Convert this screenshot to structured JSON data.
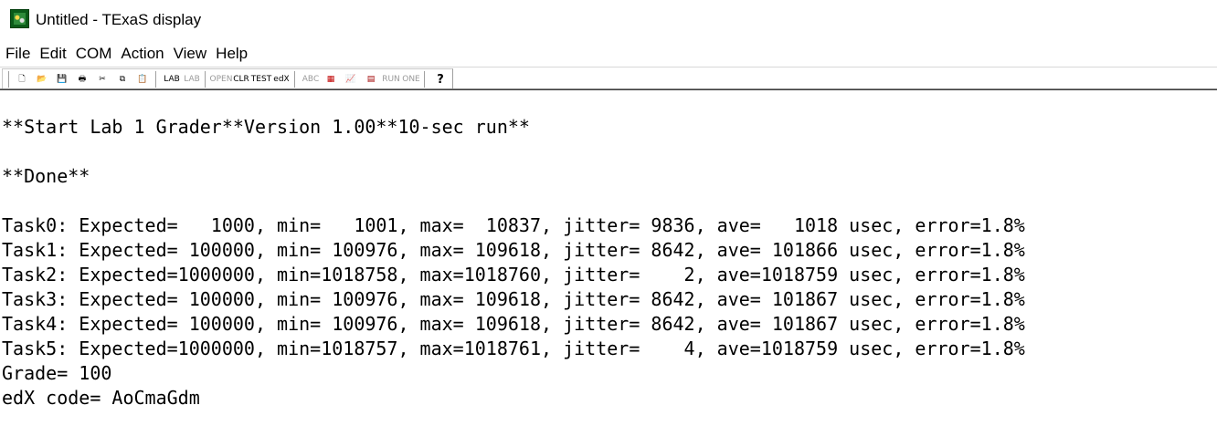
{
  "window": {
    "title": "Untitled - TExaS display"
  },
  "menu": [
    "File",
    "Edit",
    "COM",
    "Action",
    "View",
    "Help"
  ],
  "toolbar": {
    "buttons": [
      {
        "icon": "new-file-icon",
        "glyph": "🗋"
      },
      {
        "icon": "open-folder-icon",
        "glyph": "📂"
      },
      {
        "icon": "save-icon",
        "glyph": "💾"
      },
      {
        "icon": "print-icon",
        "glyph": "🖶"
      },
      {
        "icon": "cut-icon",
        "glyph": "✂"
      },
      {
        "icon": "copy-icon",
        "glyph": "⧉"
      },
      {
        "icon": "paste-icon",
        "glyph": "📋"
      },
      {
        "icon": "lab-select-icon",
        "glyph": "LAB"
      },
      {
        "icon": "lab-list-icon",
        "glyph": "LAB"
      },
      {
        "icon": "open-port-icon",
        "glyph": "OPEN"
      },
      {
        "icon": "clear-icon",
        "glyph": "CLR"
      },
      {
        "icon": "test-icon",
        "glyph": "TEST"
      },
      {
        "icon": "edx-icon",
        "glyph": "edX"
      },
      {
        "icon": "abc-def-icon",
        "glyph": "ABC"
      },
      {
        "icon": "scope-icon",
        "glyph": "▦"
      },
      {
        "icon": "graph-icon",
        "glyph": "📈"
      },
      {
        "icon": "logic-analyzer-icon",
        "glyph": "▤"
      },
      {
        "icon": "run-stop-icon",
        "glyph": "RUN"
      },
      {
        "icon": "one-icon",
        "glyph": "ONE"
      },
      {
        "icon": "help-icon",
        "glyph": "?"
      }
    ]
  },
  "console": {
    "lines": [
      "",
      "**Start Lab 1 Grader**Version 1.00**10-sec run**",
      "",
      "**Done**",
      "",
      "Task0: Expected=   1000, min=   1001, max=  10837, jitter= 9836, ave=   1018 usec, error=1.8%",
      "Task1: Expected= 100000, min= 100976, max= 109618, jitter= 8642, ave= 101866 usec, error=1.8%",
      "Task2: Expected=1000000, min=1018758, max=1018760, jitter=    2, ave=1018759 usec, error=1.8%",
      "Task3: Expected= 100000, min= 100976, max= 109618, jitter= 8642, ave= 101867 usec, error=1.8%",
      "Task4: Expected= 100000, min= 100976, max= 109618, jitter= 8642, ave= 101867 usec, error=1.8%",
      "Task5: Expected=1000000, min=1018757, max=1018761, jitter=    4, ave=1018759 usec, error=1.8%",
      "Grade= 100",
      "edX code= AoCmaGdm"
    ]
  }
}
